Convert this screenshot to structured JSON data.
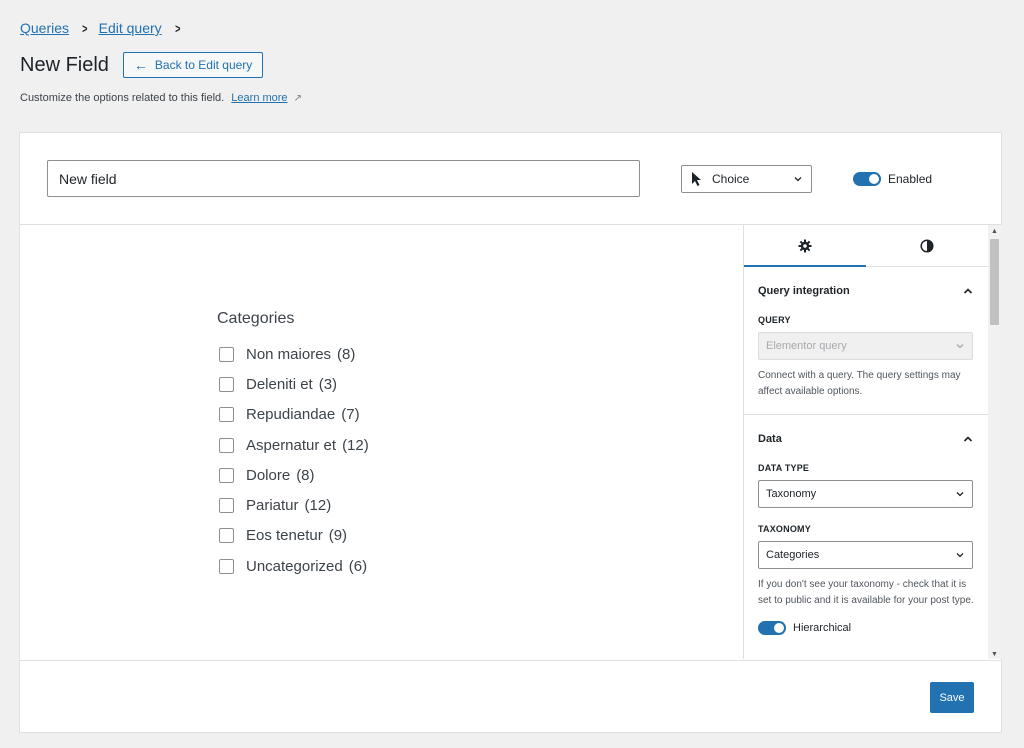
{
  "breadcrumb": {
    "items": [
      "Queries",
      "Edit query"
    ]
  },
  "header": {
    "title": "New Field",
    "back_label": "Back to Edit query"
  },
  "description": {
    "text": "Customize the options related to this field.",
    "link": "Learn more",
    "link_icon": "external-link-icon"
  },
  "field": {
    "name_value": "New field",
    "type_value": "Choice",
    "enabled_label": "Enabled",
    "enabled": true
  },
  "preview": {
    "title": "Categories",
    "items": [
      {
        "label": "Non maiores",
        "count": "(8)"
      },
      {
        "label": "Deleniti et",
        "count": "(3)"
      },
      {
        "label": "Repudiandae",
        "count": "(7)"
      },
      {
        "label": "Aspernatur et",
        "count": "(12)"
      },
      {
        "label": "Dolore",
        "count": "(8)"
      },
      {
        "label": "Pariatur",
        "count": "(12)"
      },
      {
        "label": "Eos tenetur",
        "count": "(9)"
      },
      {
        "label": "Uncategorized",
        "count": "(6)"
      }
    ]
  },
  "sidebar": {
    "tabs": [
      "gear-icon",
      "contrast-icon"
    ],
    "query_panel": {
      "title": "Query integration",
      "label": "QUERY",
      "value": "Elementor query",
      "help": "Connect with a query. The query settings may affect available options."
    },
    "data_panel": {
      "title": "Data",
      "data_type_label": "DATA TYPE",
      "data_type_value": "Taxonomy",
      "taxonomy_label": "TAXONOMY",
      "taxonomy_value": "Categories",
      "help": "If you don't see your taxonomy - check that it is set to public and it is available for your post type.",
      "hierarchical_label": "Hierarchical",
      "hierarchical": true
    }
  },
  "footer": {
    "save_label": "Save"
  },
  "colors": {
    "accent": "#2271b1",
    "background": "#f0f0f1"
  }
}
